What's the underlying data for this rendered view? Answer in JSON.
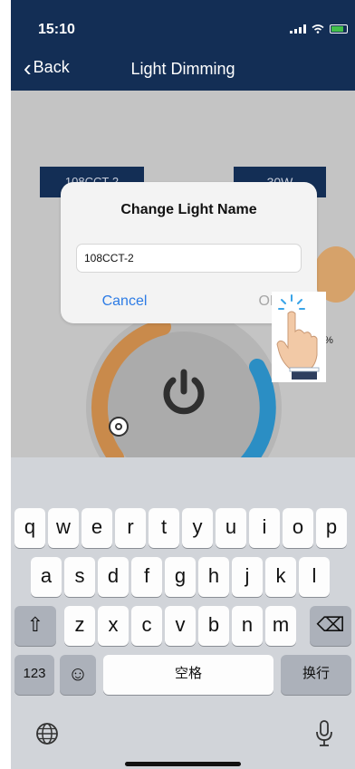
{
  "status_bar": {
    "time": "15:10"
  },
  "nav": {
    "back_label": "Back",
    "title": "Light Dimming"
  },
  "device": {
    "name_chip": "108CCT-2",
    "watt_chip": "30W",
    "percent": "2%"
  },
  "dialog": {
    "title": "Change Light Name",
    "input_value": "108CCT-2",
    "cancel_label": "Cancel",
    "ok_label": "OK"
  },
  "colors": {
    "header": "#132e55",
    "dialog_link": "#2c7be5",
    "dial_orange": "#d8904a",
    "dial_blue": "#2e96cf"
  },
  "keyboard": {
    "row1": [
      "q",
      "w",
      "e",
      "r",
      "t",
      "y",
      "u",
      "i",
      "o",
      "p"
    ],
    "row2": [
      "a",
      "s",
      "d",
      "f",
      "g",
      "h",
      "j",
      "k",
      "l"
    ],
    "row3": [
      "z",
      "x",
      "c",
      "v",
      "b",
      "n",
      "m"
    ],
    "shift_label": "⇧",
    "delete_label": "⌫",
    "numbers_label": "123",
    "emoji_label": "☺",
    "space_label": "空格",
    "return_label": "换行",
    "icons": [
      "globe-icon",
      "microphone-icon"
    ]
  }
}
